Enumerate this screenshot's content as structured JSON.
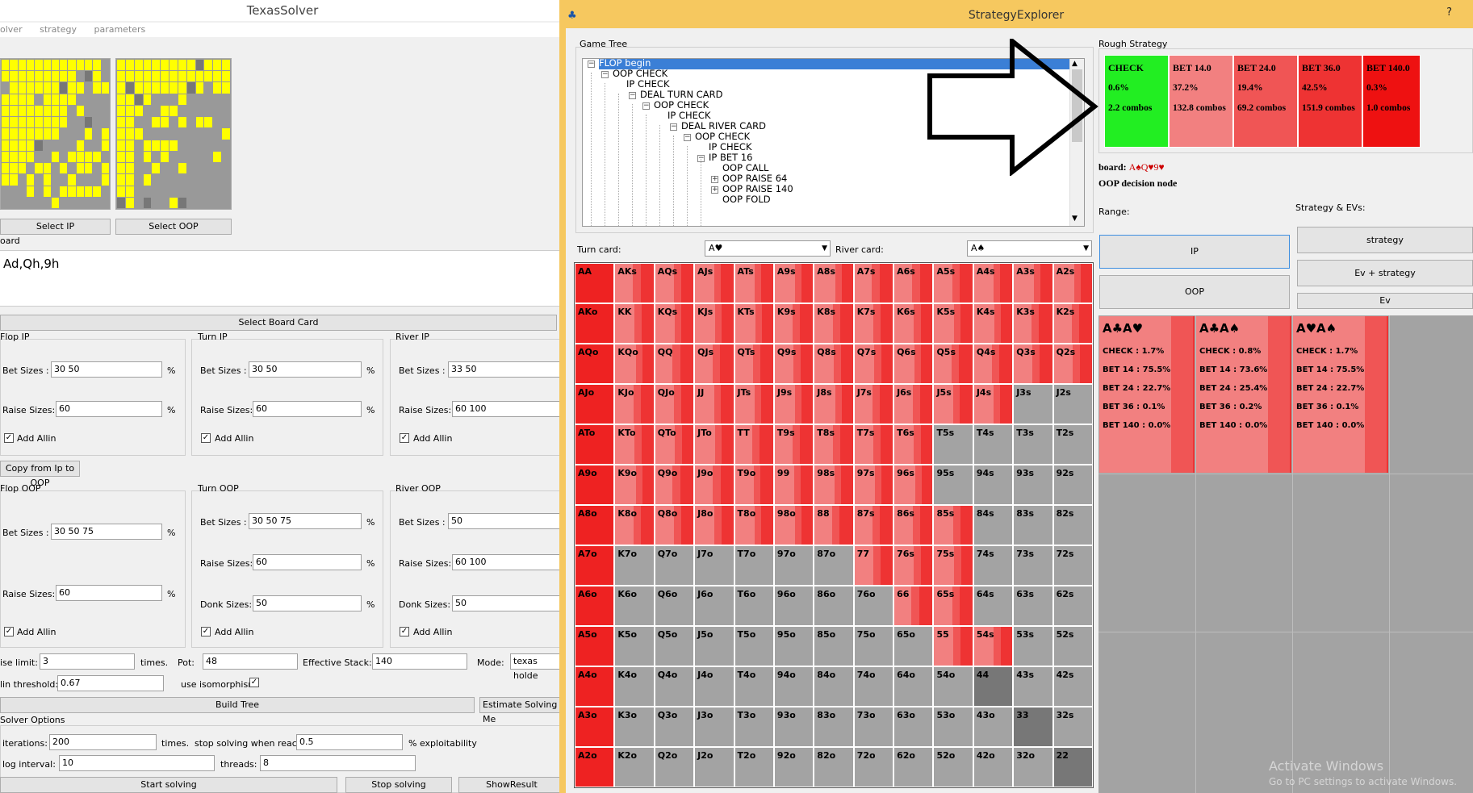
{
  "solver": {
    "title": "TexasSolver",
    "menu": [
      "olver",
      "strategy",
      "parameters"
    ],
    "select_ip": "Select IP",
    "select_oop": "Select OOP",
    "board_label": "oard",
    "board_value": "Ad,Qh,9h",
    "select_board_card": "Select Board Card",
    "flop_ip": {
      "title": "Flop IP",
      "bet_label": "Bet Sizes :",
      "bet": "30 50",
      "raise_label": "Raise Sizes:",
      "raise": "60",
      "allin": "Add Allin"
    },
    "turn_ip": {
      "title": "Turn IP",
      "bet_label": "Bet Sizes :",
      "bet": "30 50",
      "raise_label": "Raise Sizes:",
      "raise": "60",
      "allin": "Add Allin"
    },
    "river_ip": {
      "title": "River IP",
      "bet_label": "Bet Sizes :",
      "bet": "33 50",
      "raise_label": "Raise Sizes:",
      "raise": "60 100",
      "allin": "Add Allin"
    },
    "copy_ip_oop": "Copy from Ip to OOP",
    "flop_oop": {
      "title": "Flop OOP",
      "bet_label": "Bet Sizes :",
      "bet": "30 50 75",
      "raise_label": "Raise Sizes:",
      "raise": "60",
      "allin": "Add Allin"
    },
    "turn_oop": {
      "title": "Turn OOP",
      "bet_label": "Bet Sizes :",
      "bet": "30 50 75",
      "raise_label": "Raise Sizes:",
      "raise": "60",
      "donk_label": "Donk Sizes:",
      "donk": "50",
      "allin": "Add Allin"
    },
    "river_oop": {
      "title": "River OOP",
      "bet_label": "Bet Sizes :",
      "bet": "50",
      "raise_label": "Raise Sizes:",
      "raise": "60 100",
      "donk_label": "Donk Sizes:",
      "donk": "50",
      "allin": "Add Allin"
    },
    "percent": "%",
    "raise_limit_label": "ise limit:",
    "raise_limit": "3",
    "times": "times.",
    "pot_label": "Pot:",
    "pot": "48",
    "eff_stack_label": "Effective Stack:",
    "eff_stack": "140",
    "mode_label": "Mode:",
    "mode": "texas holde",
    "allin_threshold_label": "lin threshold:",
    "allin_threshold": "0.67",
    "use_iso": "use isomorphism",
    "build_tree": "Build Tree",
    "estimate": "Estimate Solving Me",
    "solver_options": "Solver Options",
    "iterations_label": "iterations:",
    "iterations": "200",
    "times2": "times.",
    "stop_label": "stop solving when reach",
    "stop_value": "0.5",
    "exploitability": "% exploitability",
    "log_interval_label": "log interval:",
    "log_interval": "10",
    "threads_label": "threads:",
    "threads": "8",
    "start": "Start solving",
    "stop": "Stop solving",
    "show_result": "ShowResult"
  },
  "explorer": {
    "title": "StrategyExplorer",
    "help": "?",
    "game_tree_label": "Game Tree",
    "tree": [
      {
        "label": "FLOP begin",
        "depth": 0,
        "exp": "−",
        "sel": true
      },
      {
        "label": "OOP CHECK",
        "depth": 1,
        "exp": "−"
      },
      {
        "label": "IP CHECK",
        "depth": 2,
        "exp": ""
      },
      {
        "label": "DEAL TURN CARD",
        "depth": 3,
        "exp": "−"
      },
      {
        "label": "OOP CHECK",
        "depth": 4,
        "exp": "−"
      },
      {
        "label": "IP CHECK",
        "depth": 5,
        "exp": ""
      },
      {
        "label": "DEAL RIVER CARD",
        "depth": 6,
        "exp": "−"
      },
      {
        "label": "OOP CHECK",
        "depth": 7,
        "exp": "−"
      },
      {
        "label": "IP CHECK",
        "depth": 8,
        "exp": ""
      },
      {
        "label": "IP BET 16",
        "depth": 8,
        "exp": "−"
      },
      {
        "label": "OOP CALL",
        "depth": 9,
        "exp": ""
      },
      {
        "label": "OOP RAISE 64",
        "depth": 9,
        "exp": "+"
      },
      {
        "label": "OOP RAISE 140",
        "depth": 9,
        "exp": "+"
      },
      {
        "label": "OOP FOLD",
        "depth": 9,
        "exp": ""
      }
    ],
    "turn_card_label": "Turn card:",
    "turn_card": "A♥",
    "river_card_label": "River card:",
    "river_card": "A♠",
    "rough_label": "Rough Strategy",
    "rough": [
      {
        "action": "CHECK",
        "pct": "0.6%",
        "combos": "2.2 combos",
        "color": "#22ee22"
      },
      {
        "action": "BET 14.0",
        "pct": "37.2%",
        "combos": "132.8 combos",
        "color": "#f28080"
      },
      {
        "action": "BET 24.0",
        "pct": "19.4%",
        "combos": "69.2 combos",
        "color": "#f05555"
      },
      {
        "action": "BET 36.0",
        "pct": "42.5%",
        "combos": "151.9 combos",
        "color": "#ee3333"
      },
      {
        "action": "BET 140.0",
        "pct": "0.3%",
        "combos": "1.0 combos",
        "color": "#ee1111"
      }
    ],
    "board_prefix": "board:",
    "board_cards": "A♠Q♥9♥",
    "node_info": "OOP decision node",
    "range_label": "Range:",
    "strategy_evs_label": "Strategy & EVs:",
    "btn_ip": "IP",
    "btn_oop": "OOP",
    "btn_strategy": "strategy",
    "btn_ev_strategy": "Ev + strategy",
    "btn_ev": "Ev",
    "hands": [
      [
        "AA",
        "AKs",
        "AQs",
        "AJs",
        "ATs",
        "A9s",
        "A8s",
        "A7s",
        "A6s",
        "A5s",
        "A4s",
        "A3s",
        "A2s"
      ],
      [
        "AKo",
        "KK",
        "KQs",
        "KJs",
        "KTs",
        "K9s",
        "K8s",
        "K7s",
        "K6s",
        "K5s",
        "K4s",
        "K3s",
        "K2s"
      ],
      [
        "AQo",
        "KQo",
        "QQ",
        "QJs",
        "QTs",
        "Q9s",
        "Q8s",
        "Q7s",
        "Q6s",
        "Q5s",
        "Q4s",
        "Q3s",
        "Q2s"
      ],
      [
        "AJo",
        "KJo",
        "QJo",
        "JJ",
        "JTs",
        "J9s",
        "J8s",
        "J7s",
        "J6s",
        "J5s",
        "J4s",
        "J3s",
        "J2s"
      ],
      [
        "ATo",
        "KTo",
        "QTo",
        "JTo",
        "TT",
        "T9s",
        "T8s",
        "T7s",
        "T6s",
        "T5s",
        "T4s",
        "T3s",
        "T2s"
      ],
      [
        "A9o",
        "K9o",
        "Q9o",
        "J9o",
        "T9o",
        "99",
        "98s",
        "97s",
        "96s",
        "95s",
        "94s",
        "93s",
        "92s"
      ],
      [
        "A8o",
        "K8o",
        "Q8o",
        "J8o",
        "T8o",
        "98o",
        "88",
        "87s",
        "86s",
        "85s",
        "84s",
        "83s",
        "82s"
      ],
      [
        "A7o",
        "K7o",
        "Q7o",
        "J7o",
        "T7o",
        "97o",
        "87o",
        "77",
        "76s",
        "75s",
        "74s",
        "73s",
        "72s"
      ],
      [
        "A6o",
        "K6o",
        "Q6o",
        "J6o",
        "T6o",
        "96o",
        "86o",
        "76o",
        "66",
        "65s",
        "64s",
        "63s",
        "62s"
      ],
      [
        "A5o",
        "K5o",
        "Q5o",
        "J5o",
        "T5o",
        "95o",
        "85o",
        "75o",
        "65o",
        "55",
        "54s",
        "53s",
        "52s"
      ],
      [
        "A4o",
        "K4o",
        "Q4o",
        "J4o",
        "T4o",
        "94o",
        "84o",
        "74o",
        "64o",
        "54o",
        "44",
        "43s",
        "42s"
      ],
      [
        "A3o",
        "K3o",
        "Q3o",
        "J3o",
        "T3o",
        "93o",
        "83o",
        "73o",
        "63o",
        "53o",
        "43o",
        "33",
        "32s"
      ],
      [
        "A2o",
        "K2o",
        "Q2o",
        "J2o",
        "T2o",
        "92o",
        "82o",
        "72o",
        "62o",
        "52o",
        "42o",
        "32o",
        "22"
      ]
    ],
    "detail_combos": [
      {
        "title": "A♣A♥",
        "check": "CHECK : 1.7%",
        "bet14": "BET 14 : 75.5%",
        "bet24": "BET 24 : 22.7%",
        "bet36": "BET 36 : 0.1%",
        "bet140": "BET 140 : 0.0%"
      },
      {
        "title": "A♣A♠",
        "check": "CHECK : 0.8%",
        "bet14": "BET 14 : 73.6%",
        "bet24": "BET 24 : 25.4%",
        "bet36": "BET 36 : 0.2%",
        "bet140": "BET 140 : 0.0%"
      },
      {
        "title": "A♥A♠",
        "check": "CHECK : 1.7%",
        "bet14": "BET 14 : 75.5%",
        "bet24": "BET 24 : 22.7%",
        "bet36": "BET 36 : 0.1%",
        "bet140": "BET 140 : 0.0%"
      }
    ],
    "watermark1": "Activate Windows",
    "watermark2": "Go to PC settings to activate Windows."
  }
}
